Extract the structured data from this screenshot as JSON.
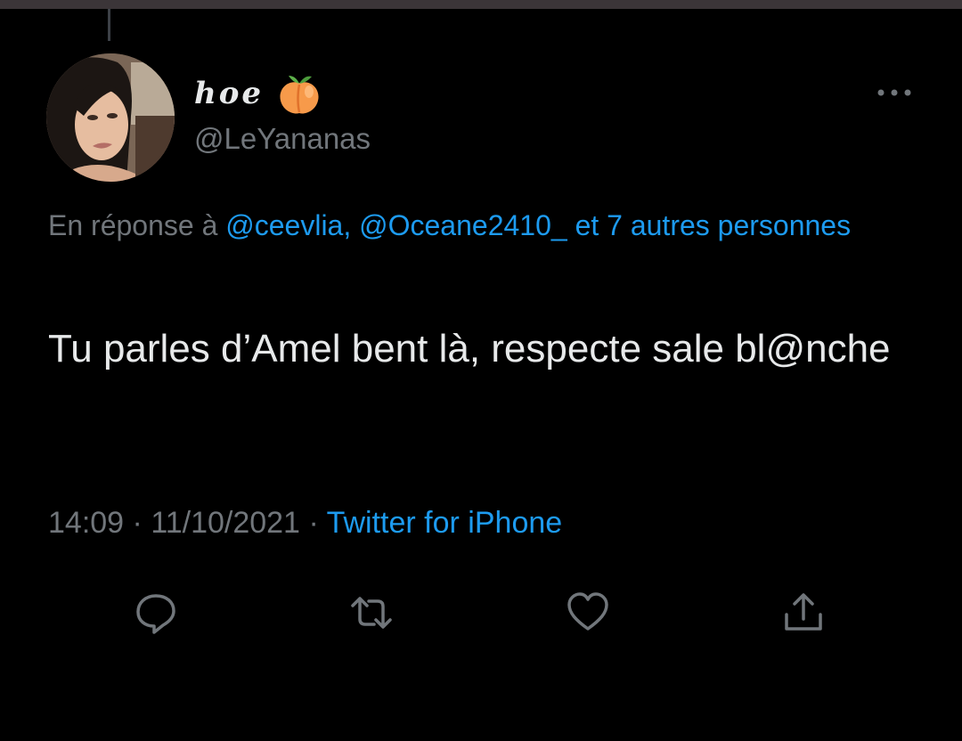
{
  "tweet": {
    "author": {
      "display_name": "hoe",
      "display_name_emoji": "peach-emoji",
      "username": "@LeYananas",
      "avatar": "profile-photo"
    },
    "reply_prefix": "En réponse à",
    "reply_mentions": "@ceevlia, @Oceane2410_",
    "reply_others": "et 7 autres personnes",
    "text": "Tu parles d’Amel bent là, respecte sale bl@nche",
    "time": "14:09",
    "separator": "·",
    "date": "11/10/2021",
    "source": "Twitter for iPhone"
  },
  "actions": {
    "reply_icon": "speech-bubble-icon",
    "retweet_icon": "retweet-icon",
    "like_icon": "heart-icon",
    "share_icon": "share-upload-icon"
  },
  "colors": {
    "background": "#000000",
    "text_primary": "#e7e9ea",
    "text_secondary": "#71767b",
    "link": "#1d9bf0",
    "peach": "#f79a4a"
  }
}
